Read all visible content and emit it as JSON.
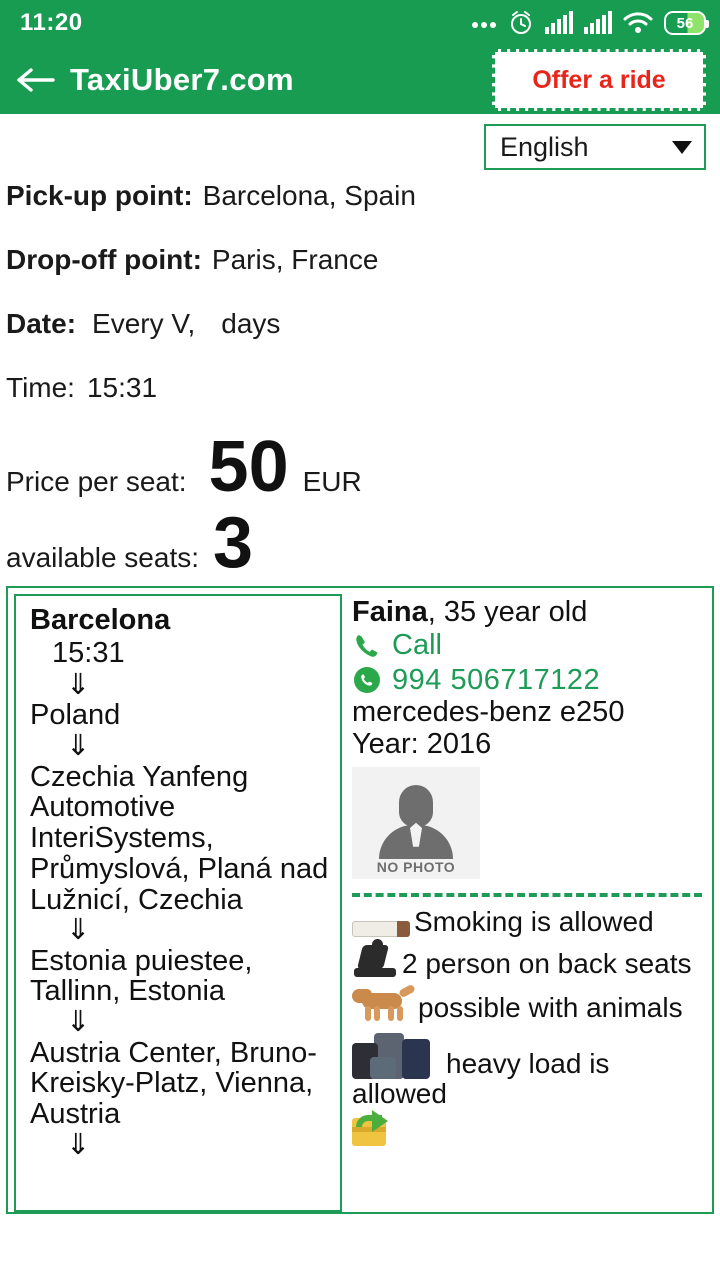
{
  "statusbar": {
    "time": "11:20",
    "battery_percent": "56",
    "icons": [
      "more-dots-icon",
      "alarm-clock-icon",
      "signal-bars-icon",
      "signal-bars-icon",
      "wifi-icon",
      "battery-icon"
    ]
  },
  "appbar": {
    "back_icon": "back-arrow-icon",
    "title": "TaxiUber7.com",
    "offer_button": "Offer a ride"
  },
  "language": {
    "selected": "English",
    "caret_icon": "chevron-down-icon"
  },
  "trip": {
    "pickup_label": "Pick-up point:",
    "pickup_value": "Barcelona, Spain",
    "dropoff_label": "Drop-off point:",
    "dropoff_value": "Paris, France",
    "date_label": "Date:",
    "date_value": "Every V,",
    "date_value2": "days",
    "time_label": "Time:",
    "time_value": "15:31",
    "price_label": "Price per seat:",
    "price_value": "50",
    "price_currency": "EUR",
    "seats_label": "available seats:",
    "seats_value": "3"
  },
  "route": {
    "origin": "Barcelona",
    "origin_time": "15:31",
    "arrow": "⇓",
    "stops": [
      "Poland",
      "Czechia Yanfeng Automotive InteriSystems, Průmyslová, Planá nad Lužnicí, Czechia",
      "Estonia puiestee, Tallinn, Estonia",
      "Austria Center, Bruno-Kreisky-Platz, Vienna, Austria"
    ]
  },
  "driver": {
    "name": "Faina",
    "age_text": ", 35 year old",
    "call_label": "Call",
    "call_icon": "phone-icon",
    "whatsapp_icon": "whatsapp-icon",
    "phone_number": "994 506717122",
    "car_model": "mercedes-benz e250",
    "car_year": "Year: 2016",
    "photo_placeholder": "NO PHOTO"
  },
  "amenities": [
    {
      "icon": "cigarette-icon",
      "text": "Smoking is allowed"
    },
    {
      "icon": "car-seat-icon",
      "text": "2 person on back seats"
    },
    {
      "icon": "dog-icon",
      "text": "possible with animals"
    },
    {
      "icon": "luggage-icon",
      "text": "heavy load is allowed"
    },
    {
      "icon": "parcel-icon",
      "text": ""
    }
  ],
  "colors": {
    "brand_green": "#179c52",
    "border_green": "#1d9b57",
    "accent_red": "#e8251b",
    "link_green": "#1d9b57"
  }
}
